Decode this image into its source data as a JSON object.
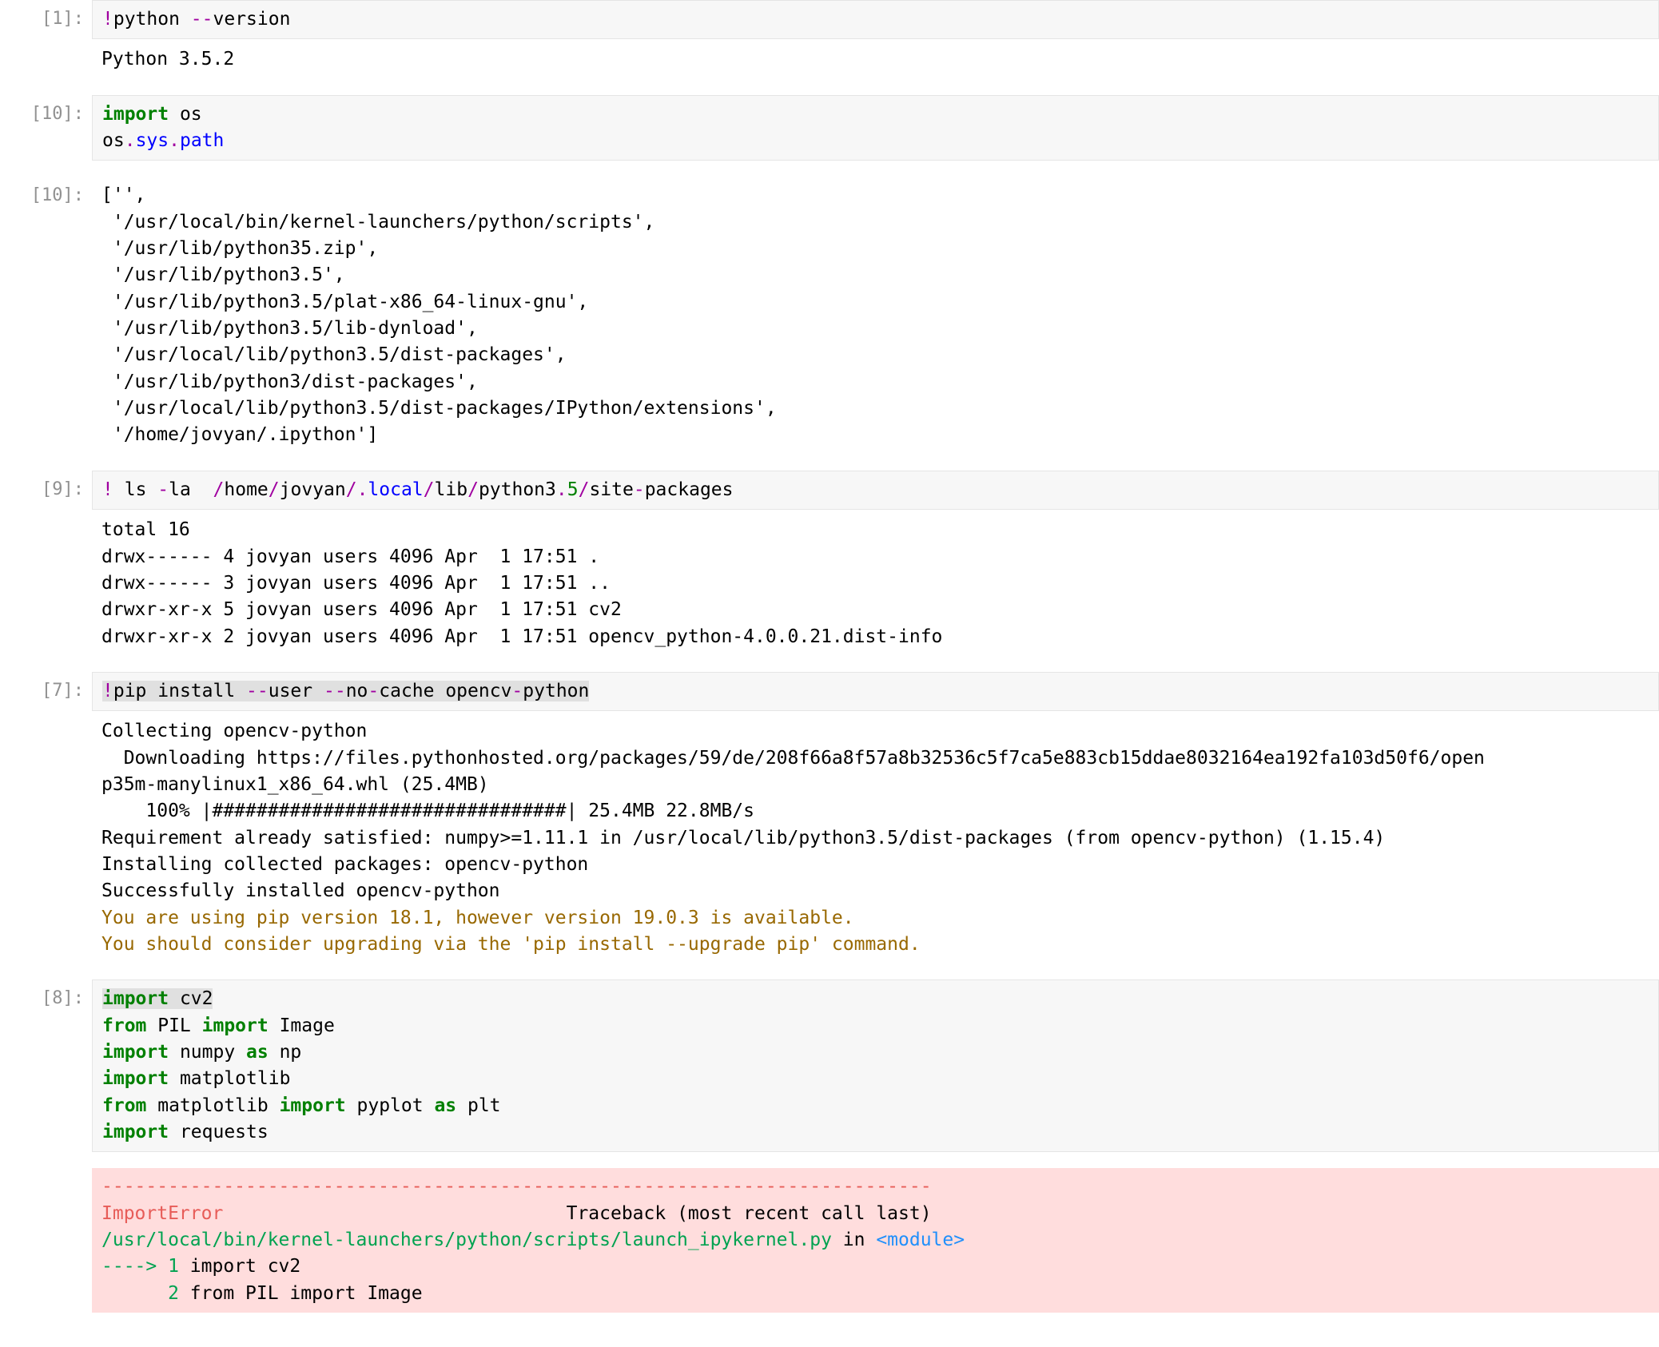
{
  "cells": {
    "c1": {
      "prompt": "[1]:",
      "code": {
        "bang": "!",
        "cmd": "python ",
        "flag": "--",
        "flagword": "version"
      },
      "output": "Python 3.5.2"
    },
    "c10a": {
      "prompt": "[10]:",
      "code": {
        "kw_import": "import",
        "os": " os",
        "l2a": "os",
        "dot1": ".",
        "sys": "sys",
        "dot2": ".",
        "path": "path"
      }
    },
    "c10b": {
      "prompt": "[10]:",
      "output": "['',\n '/usr/local/bin/kernel-launchers/python/scripts',\n '/usr/lib/python35.zip',\n '/usr/lib/python3.5',\n '/usr/lib/python3.5/plat-x86_64-linux-gnu',\n '/usr/lib/python3.5/lib-dynload',\n '/usr/local/lib/python3.5/dist-packages',\n '/usr/lib/python3/dist-packages',\n '/usr/local/lib/python3.5/dist-packages/IPython/extensions',\n '/home/jovyan/.ipython']"
    },
    "c9": {
      "prompt": "[9]:",
      "code": {
        "bang": "!",
        "sp": " ",
        "ls": "ls ",
        "dash1": "-",
        "flag": "la  ",
        "seg1": "/",
        "home": "home",
        "seg2": "/",
        "jovyan": "jovyan",
        "seg3": "/.",
        "local": "local",
        "seg4": "/",
        "lib": "lib",
        "seg5": "/",
        "py": "python3",
        "dot": ".",
        "five": "5",
        "seg6": "/",
        "site": "site",
        "dash2": "-",
        "packages": "packages"
      },
      "output": "total 16\ndrwx------ 4 jovyan users 4096 Apr  1 17:51 .\ndrwx------ 3 jovyan users 4096 Apr  1 17:51 ..\ndrwxr-xr-x 5 jovyan users 4096 Apr  1 17:51 cv2\ndrwxr-xr-x 2 jovyan users 4096 Apr  1 17:51 opencv_python-4.0.0.21.dist-info"
    },
    "c7": {
      "prompt": "[7]:",
      "highlighted": "!pip install --user --no-cache opencv-python",
      "code": {
        "bang": "!",
        "pip": "pip install ",
        "dd1": "--",
        "user": "user ",
        "dd2": "--",
        "no": "no",
        "dash1": "-",
        "cache": "cache opencv",
        "dash2": "-",
        "python": "python"
      },
      "output_plain": "Collecting opencv-python\n  Downloading https://files.pythonhosted.org/packages/59/de/208f66a8f57a8b32536c5f7ca5e883cb15ddae8032164ea192fa103d50f6/open\np35m-manylinux1_x86_64.whl (25.4MB)\n    100% |################################| 25.4MB 22.8MB/s\nRequirement already satisfied: numpy>=1.11.1 in /usr/local/lib/python3.5/dist-packages (from opencv-python) (1.15.4)\nInstalling collected packages: opencv-python\nSuccessfully installed opencv-python",
      "output_warn": "You are using pip version 18.1, however version 19.0.3 is available.\nYou should consider upgrading via the 'pip install --upgrade pip' command."
    },
    "c8": {
      "prompt": "[8]:",
      "code": {
        "l1_import": "import",
        "l1_cv2": " cv2",
        "l2_from": "from",
        "l2_pil": " PIL ",
        "l2_import": "import",
        "l2_image": " Image",
        "l3_import": "import",
        "l3_numpy": " numpy ",
        "l3_as": "as",
        "l3_np": " np",
        "l4_import": "import",
        "l4_mpl": " matplotlib",
        "l5_from": "from",
        "l5_mpl": " matplotlib ",
        "l5_import": "import",
        "l5_pyplot": " pyplot ",
        "l5_as": "as",
        "l5_plt": " plt",
        "l6_import": "import",
        "l6_req": " requests"
      },
      "error": {
        "dashline": "---------------------------------------------------------------------------",
        "err_name": "ImportError",
        "err_pad": "                               ",
        "tb": "Traceback (most recent call last)",
        "path": "/usr/local/bin/kernel-launchers/python/scripts/launch_ipykernel.py",
        "in_": " in ",
        "module": "<module>",
        "arrow": "----> 1",
        "l1": " import cv2",
        "n2": "      2",
        "l2": " from PIL import Image"
      }
    }
  }
}
